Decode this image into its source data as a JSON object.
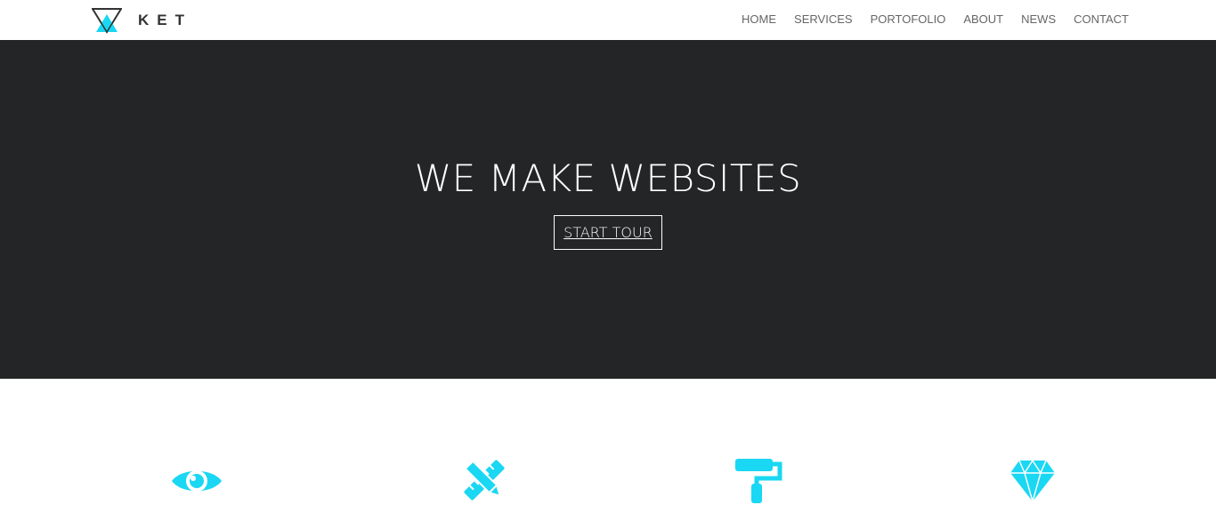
{
  "brand": {
    "name": "KET",
    "accent": "#1ad7f3"
  },
  "nav": {
    "items": [
      {
        "label": "HOME"
      },
      {
        "label": "SERVICES"
      },
      {
        "label": "PORTOFOLIO"
      },
      {
        "label": "ABOUT"
      },
      {
        "label": "NEWS"
      },
      {
        "label": "CONTACT"
      }
    ]
  },
  "hero": {
    "title": "WE MAKE WEBSITES",
    "button_label": "START TOUR",
    "background": "#242526"
  },
  "features": {
    "icons": [
      "eye-icon",
      "pencil-ruler-icon",
      "paint-roller-icon",
      "diamond-icon"
    ]
  }
}
